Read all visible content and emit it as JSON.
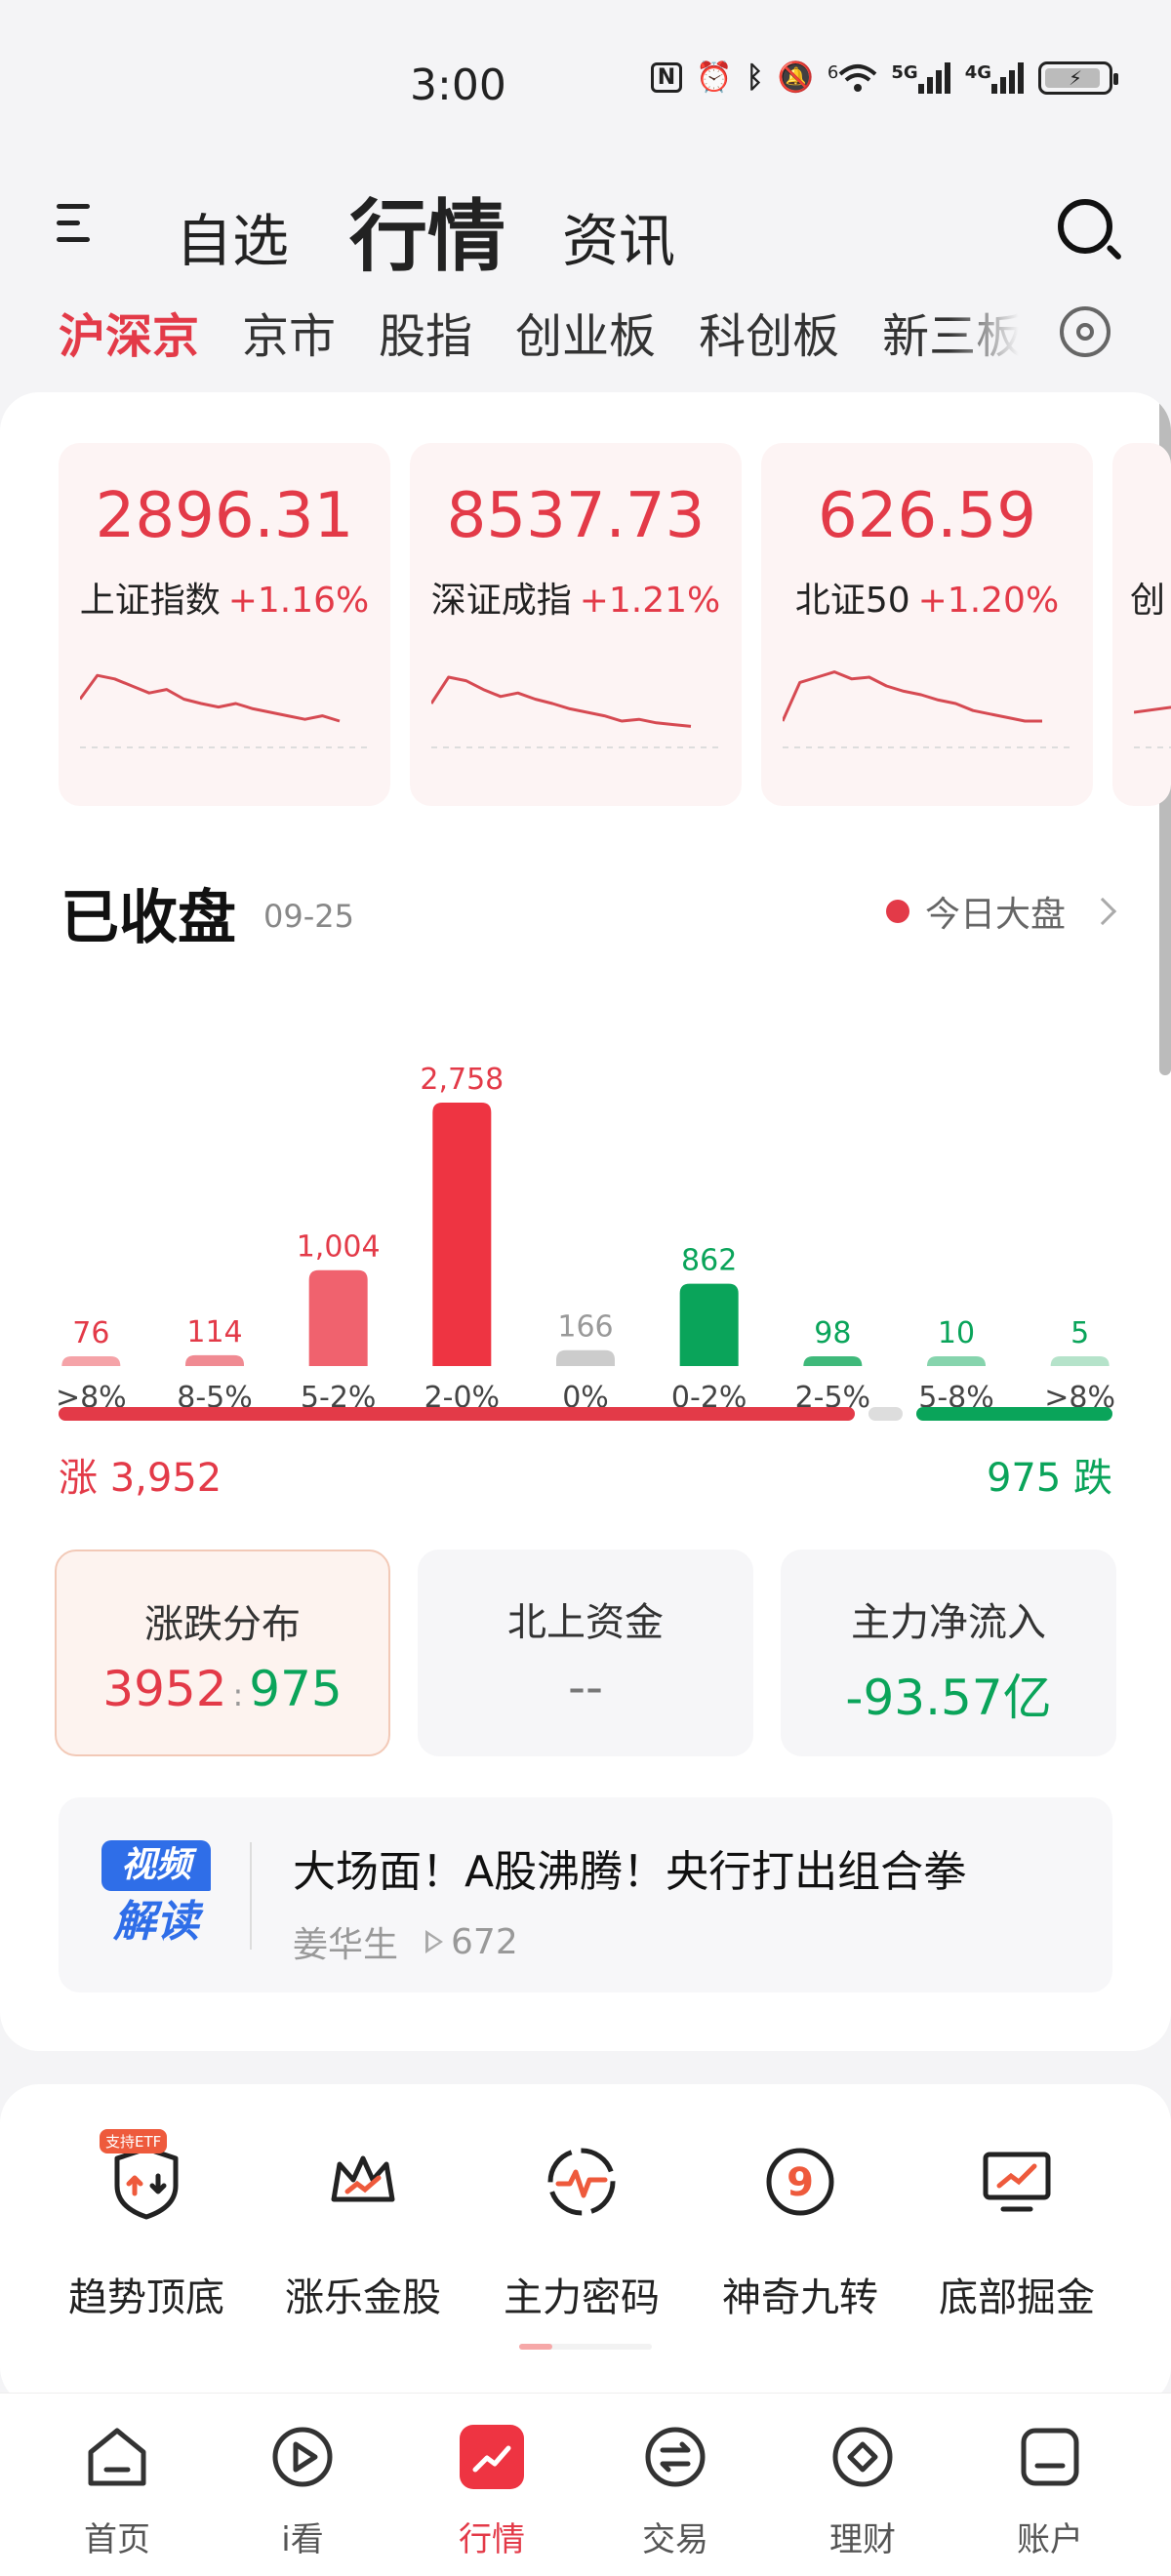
{
  "status_bar": {
    "time": "3:00",
    "indicators": [
      "nfc-icon",
      "alarm-icon",
      "bluetooth-icon",
      "mute-icon",
      "wifi-6-icon",
      "5g-signal-icon",
      "4g-signal-icon"
    ],
    "wifi_label": "6",
    "net1": "5G",
    "net2": "4G",
    "battery_icon": "battery-charging-icon"
  },
  "header": {
    "menu_label": "三",
    "tabs": [
      "自选",
      "行情",
      "资讯"
    ],
    "active_tab": 1
  },
  "subtabs": {
    "items": [
      "沪深京",
      "京市",
      "股指",
      "创业板",
      "科创板",
      "新三板"
    ],
    "active": 0
  },
  "indices": [
    {
      "value": "2896.31",
      "name": "上证指数",
      "change": "+1.16%",
      "trend": [
        0.55,
        0.82,
        0.78,
        0.7,
        0.62,
        0.66,
        0.55,
        0.5,
        0.46,
        0.5,
        0.44,
        0.4,
        0.36,
        0.32,
        0.36,
        0.3
      ]
    },
    {
      "value": "8537.73",
      "name": "深证成指",
      "change": "+1.21%",
      "trend": [
        0.5,
        0.8,
        0.76,
        0.66,
        0.58,
        0.62,
        0.55,
        0.5,
        0.44,
        0.4,
        0.36,
        0.3,
        0.32,
        0.28,
        0.26,
        0.24
      ]
    },
    {
      "value": "626.59",
      "name": "北证50",
      "change": "+1.20%",
      "trend": [
        0.3,
        0.74,
        0.8,
        0.86,
        0.78,
        0.8,
        0.7,
        0.64,
        0.6,
        0.54,
        0.5,
        0.42,
        0.38,
        0.34,
        0.3,
        0.3
      ]
    },
    {
      "value": "",
      "name": "创",
      "change": "",
      "trend": [
        0.4,
        0.6,
        0.5
      ]
    }
  ],
  "market_close": {
    "title": "已收盘",
    "date": "09-25",
    "today_link": "今日大盘"
  },
  "chart_data": {
    "type": "bar",
    "categories": [
      ">8%",
      "8-5%",
      "5-2%",
      "2-0%",
      "0%",
      "0-2%",
      "2-5%",
      "5-8%",
      ">8%"
    ],
    "values": [
      76,
      114,
      1004,
      2758,
      166,
      862,
      98,
      10,
      5
    ],
    "value_labels": [
      "76",
      "114",
      "1,004",
      "2,758",
      "166",
      "862",
      "98",
      "10",
      "5"
    ],
    "colors": [
      "#f5a3a8",
      "#f08a92",
      "#f0626e",
      "#ee3442",
      "#cccccc",
      "#0aa45a",
      "#3fb97a",
      "#86d4ad",
      "#b5e3ca"
    ],
    "label_colors": [
      "#e33a48",
      "#e33a48",
      "#e33a48",
      "#e33a48",
      "#999999",
      "#0aa45a",
      "#0aa45a",
      "#0aa45a",
      "#0aa45a"
    ],
    "ylim": [
      0,
      2758
    ]
  },
  "breadth": {
    "up_label": "涨 3,952",
    "down_label": "975 跌",
    "up": 3952,
    "flat": 166,
    "down": 975
  },
  "stats": [
    {
      "title": "涨跌分布",
      "up": "3952",
      "sep": ":",
      "down": "975"
    },
    {
      "title": "北上资金",
      "value": "--"
    },
    {
      "title": "主力净流入",
      "value": "-93.57亿"
    }
  ],
  "video": {
    "badge_top": "视频",
    "badge_bottom": "解读",
    "title": "大场面！A股沸腾！央行打出组合拳",
    "author": "姜华生",
    "views": "672"
  },
  "tools": [
    {
      "label": "趋势顶底",
      "icon": "trend-shield-icon",
      "tag": "支持ETF"
    },
    {
      "label": "涨乐金股",
      "icon": "crown-chart-icon"
    },
    {
      "label": "主力密码",
      "icon": "pulse-circle-icon"
    },
    {
      "label": "神奇九转",
      "icon": "nine-circle-icon",
      "glyph": "9"
    },
    {
      "label": "底部掘金",
      "icon": "monitor-chart-icon"
    }
  ],
  "tabbar": {
    "items": [
      {
        "label": "首页",
        "icon": "home-icon"
      },
      {
        "label": "i看",
        "icon": "play-circle-icon"
      },
      {
        "label": "行情",
        "icon": "market-chart-icon"
      },
      {
        "label": "交易",
        "icon": "exchange-icon"
      },
      {
        "label": "理财",
        "icon": "wealth-diamond-icon"
      },
      {
        "label": "账户",
        "icon": "account-icon"
      }
    ],
    "active": 2
  },
  "colors": {
    "up": "#e33a48",
    "down": "#0aa45a",
    "accent": "#e33a48",
    "video_blue": "#2f6ee8"
  }
}
